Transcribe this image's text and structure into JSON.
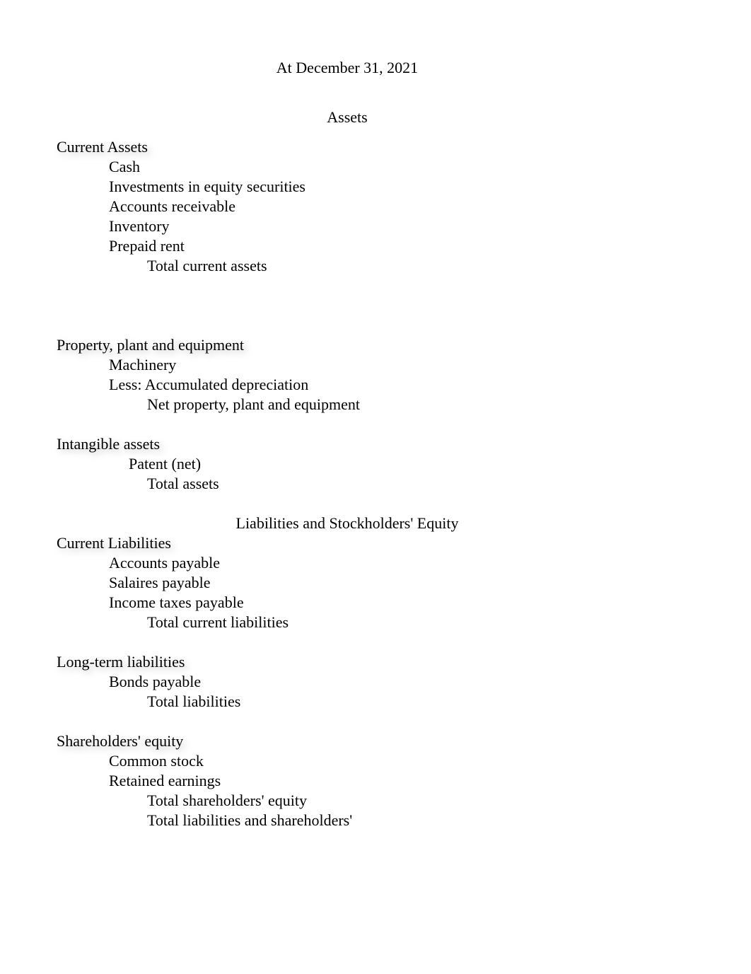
{
  "header": {
    "date": "At December 31, 2021",
    "assets_title": "Assets",
    "liabilities_title": "Liabilities and Stockholders' Equity"
  },
  "assets": {
    "current": {
      "heading": "Current Assets",
      "items": {
        "cash": "Cash",
        "investments": "Investments in equity securities",
        "ar": "Accounts receivable",
        "inventory": "Inventory",
        "prepaid_rent": "Prepaid rent"
      },
      "total": "Total current assets"
    },
    "ppe": {
      "heading": "Property, plant and equipment",
      "items": {
        "machinery": "Machinery",
        "less_depr": "Less: Accumulated depreciation"
      },
      "net": "Net property, plant and equipment"
    },
    "intangible": {
      "heading": "Intangible assets",
      "patent": "Patent (net)",
      "total_assets": "Total assets"
    }
  },
  "liabilities": {
    "current": {
      "heading": "Current Liabilities",
      "items": {
        "ap": "Accounts payable",
        "salaries": "Salaires payable",
        "income_tax": "Income taxes payable"
      },
      "total": "Total current liabilities"
    },
    "longterm": {
      "heading": "Long-term liabilities",
      "bonds": "Bonds payable",
      "total": "Total liabilities"
    }
  },
  "equity": {
    "heading": "Shareholders'  equity",
    "common_stock": "Common stock",
    "retained_earnings": "Retained earnings",
    "total_equity": "Total shareholders' equity",
    "total_all": "Total liabilities and shareholders'"
  }
}
